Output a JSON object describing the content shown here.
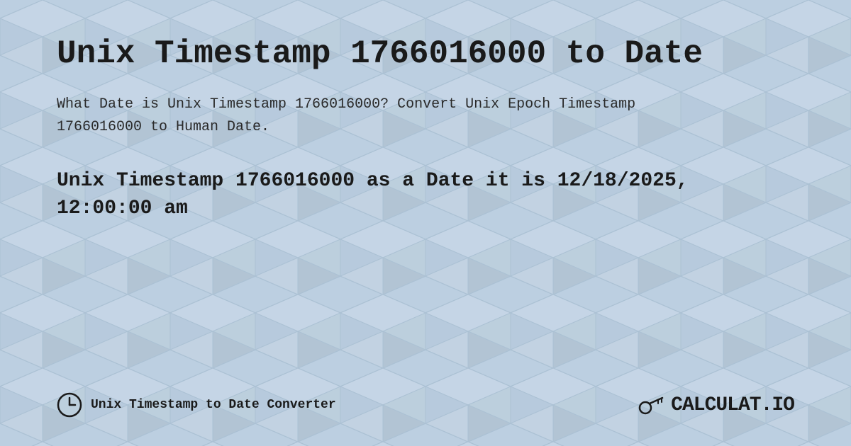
{
  "background": {
    "color": "#c8d8e8",
    "pattern": "diamond-grid"
  },
  "header": {
    "title": "Unix Timestamp 1766016000 to Date"
  },
  "description": {
    "text": "What Date is Unix Timestamp 1766016000? Convert Unix Epoch Timestamp 1766016000 to Human Date."
  },
  "result": {
    "text": "Unix Timestamp 1766016000 as a Date it is 12/18/2025, 12:00:00 am"
  },
  "footer": {
    "converter_label": "Unix Timestamp to Date Converter",
    "logo_text": "CALCULAT.IO"
  }
}
